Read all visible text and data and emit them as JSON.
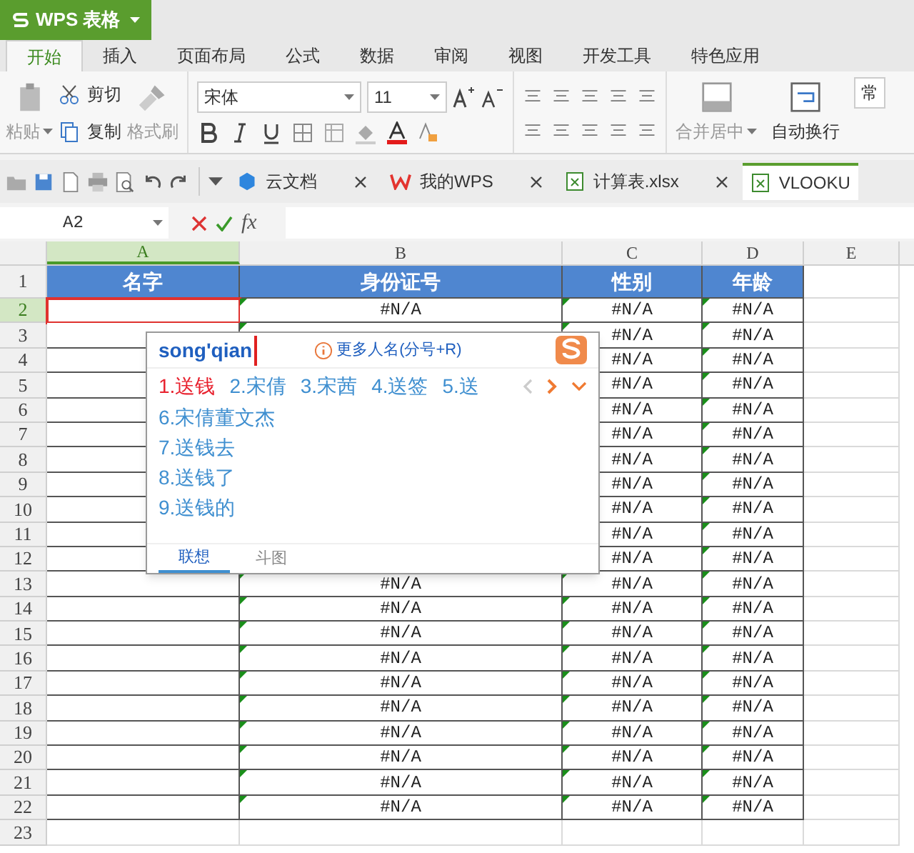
{
  "app": {
    "title": "WPS 表格"
  },
  "ribbon_tabs": [
    {
      "label": "开始",
      "selected": true
    },
    {
      "label": "插入",
      "selected": false
    },
    {
      "label": "页面布局",
      "selected": false
    },
    {
      "label": "公式",
      "selected": false
    },
    {
      "label": "数据",
      "selected": false
    },
    {
      "label": "审阅",
      "selected": false
    },
    {
      "label": "视图",
      "selected": false
    },
    {
      "label": "开发工具",
      "selected": false
    },
    {
      "label": "特色应用",
      "selected": false
    }
  ],
  "ribbon": {
    "paste": "粘贴",
    "cut": "剪切",
    "copy": "复制",
    "format_painter": "格式刷",
    "font": "宋体",
    "font_size": "11",
    "merge": "合并居中",
    "wrap": "自动换行",
    "style": "常"
  },
  "doc_tabs": [
    {
      "label": "云文档",
      "kind": "cloud",
      "selected": false,
      "closable": true
    },
    {
      "label": "我的WPS",
      "kind": "wps",
      "selected": false,
      "closable": true
    },
    {
      "label": "计算表.xlsx",
      "kind": "sheet",
      "selected": false,
      "closable": true
    },
    {
      "label": "VLOOKU",
      "kind": "sheet",
      "selected": true,
      "closable": false
    }
  ],
  "formula_bar": {
    "name_box": "A2",
    "fx": "fx"
  },
  "columns": [
    {
      "label": "A",
      "selected": true
    },
    {
      "label": "B",
      "selected": false
    },
    {
      "label": "C",
      "selected": false
    },
    {
      "label": "D",
      "selected": false
    },
    {
      "label": "E",
      "selected": false
    }
  ],
  "rows": [
    {
      "number": "1",
      "kind": "header",
      "selected": false,
      "flagged": false,
      "a": "名字",
      "b": "身份证号",
      "c": "性别",
      "d": "年龄"
    },
    {
      "number": "2",
      "kind": "data",
      "selected": true,
      "flagged": true,
      "b": "#N/A",
      "c": "#N/A",
      "d": "#N/A"
    },
    {
      "number": "3",
      "kind": "data",
      "selected": false,
      "flagged": true,
      "c": "#N/A",
      "d": "#N/A"
    },
    {
      "number": "4",
      "kind": "data",
      "selected": false,
      "flagged": true,
      "c": "#N/A",
      "d": "#N/A"
    },
    {
      "number": "5",
      "kind": "data",
      "selected": false,
      "flagged": true,
      "c": "#N/A",
      "d": "#N/A"
    },
    {
      "number": "6",
      "kind": "data",
      "selected": false,
      "flagged": true,
      "c": "#N/A",
      "d": "#N/A"
    },
    {
      "number": "7",
      "kind": "data",
      "selected": false,
      "flagged": true,
      "c": "#N/A",
      "d": "#N/A"
    },
    {
      "number": "8",
      "kind": "data",
      "selected": false,
      "flagged": true,
      "c": "#N/A",
      "d": "#N/A"
    },
    {
      "number": "9",
      "kind": "data",
      "selected": false,
      "flagged": true,
      "c": "#N/A",
      "d": "#N/A"
    },
    {
      "number": "10",
      "kind": "data",
      "selected": false,
      "flagged": true,
      "c": "#N/A",
      "d": "#N/A"
    },
    {
      "number": "11",
      "kind": "data",
      "selected": false,
      "flagged": true,
      "c": "#N/A",
      "d": "#N/A"
    },
    {
      "number": "12",
      "kind": "data",
      "selected": false,
      "flagged": true,
      "c": "#N/A",
      "d": "#N/A"
    },
    {
      "number": "13",
      "kind": "data",
      "selected": false,
      "flagged": true,
      "b": "#N/A",
      "c": "#N/A",
      "d": "#N/A"
    },
    {
      "number": "14",
      "kind": "data",
      "selected": false,
      "flagged": true,
      "b": "#N/A",
      "c": "#N/A",
      "d": "#N/A"
    },
    {
      "number": "15",
      "kind": "data",
      "selected": false,
      "flagged": true,
      "b": "#N/A",
      "c": "#N/A",
      "d": "#N/A"
    },
    {
      "number": "16",
      "kind": "data",
      "selected": false,
      "flagged": true,
      "b": "#N/A",
      "c": "#N/A",
      "d": "#N/A"
    },
    {
      "number": "17",
      "kind": "data",
      "selected": false,
      "flagged": true,
      "b": "#N/A",
      "c": "#N/A",
      "d": "#N/A"
    },
    {
      "number": "18",
      "kind": "data",
      "selected": false,
      "flagged": true,
      "b": "#N/A",
      "c": "#N/A",
      "d": "#N/A"
    },
    {
      "number": "19",
      "kind": "data",
      "selected": false,
      "flagged": true,
      "b": "#N/A",
      "c": "#N/A",
      "d": "#N/A"
    },
    {
      "number": "20",
      "kind": "data",
      "selected": false,
      "flagged": true,
      "b": "#N/A",
      "c": "#N/A",
      "d": "#N/A"
    },
    {
      "number": "21",
      "kind": "data",
      "selected": false,
      "flagged": true,
      "b": "#N/A",
      "c": "#N/A",
      "d": "#N/A"
    },
    {
      "number": "22",
      "kind": "data",
      "selected": false,
      "flagged": true,
      "b": "#N/A",
      "c": "#N/A",
      "d": "#N/A"
    },
    {
      "number": "23",
      "kind": "blank",
      "selected": false,
      "flagged": false
    }
  ],
  "ime": {
    "input": "song'qian",
    "hint": "更多人名(分号+R)",
    "candidates": [
      {
        "label": "1.送钱",
        "selected": true
      },
      {
        "label": "2.宋倩",
        "selected": false
      },
      {
        "label": "3.宋茜",
        "selected": false
      },
      {
        "label": "4.送签",
        "selected": false
      },
      {
        "label": "5.送",
        "selected": false
      }
    ],
    "more_candidates": [
      {
        "label": "6.宋倩董文杰",
        "selected": false
      },
      {
        "label": "7.送钱去",
        "selected": false
      },
      {
        "label": "8.送钱了",
        "selected": false
      },
      {
        "label": "9.送钱的",
        "selected": false
      }
    ],
    "tabs": [
      {
        "label": "联想",
        "selected": true
      },
      {
        "label": "斗图",
        "selected": false
      }
    ]
  }
}
